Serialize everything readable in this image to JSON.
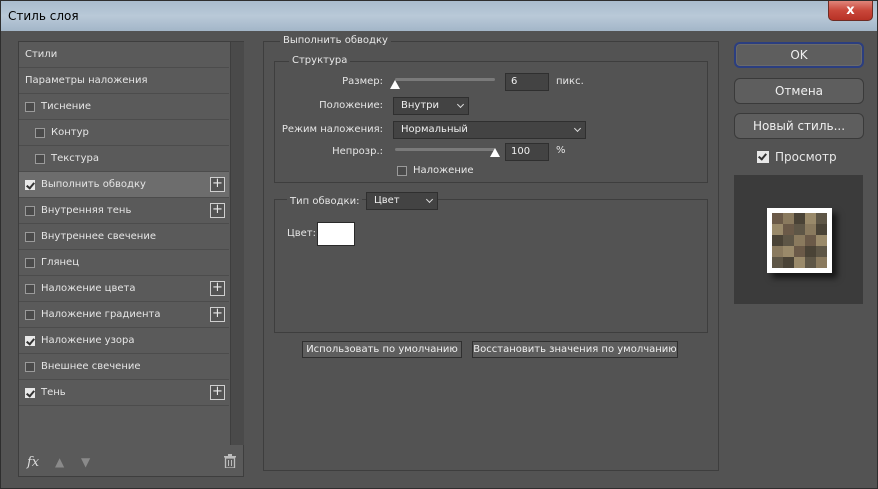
{
  "window": {
    "title": "Стиль слоя",
    "close_label": "x"
  },
  "left_panel": {
    "items": [
      {
        "label": "Стили",
        "checkbox": false,
        "checked": false,
        "indent": 0,
        "plus": false,
        "active": false
      },
      {
        "label": "Параметры наложения",
        "checkbox": false,
        "checked": false,
        "indent": 0,
        "plus": false,
        "active": false
      },
      {
        "label": "Тиснение",
        "checkbox": true,
        "checked": false,
        "indent": 0,
        "plus": false,
        "active": false
      },
      {
        "label": "Контур",
        "checkbox": true,
        "checked": false,
        "indent": 1,
        "plus": false,
        "active": false
      },
      {
        "label": "Текстура",
        "checkbox": true,
        "checked": false,
        "indent": 1,
        "plus": false,
        "active": false
      },
      {
        "label": "Выполнить обводку",
        "checkbox": true,
        "checked": true,
        "indent": 0,
        "plus": true,
        "active": true
      },
      {
        "label": "Внутренняя тень",
        "checkbox": true,
        "checked": false,
        "indent": 0,
        "plus": true,
        "active": false
      },
      {
        "label": "Внутреннее свечение",
        "checkbox": true,
        "checked": false,
        "indent": 0,
        "plus": false,
        "active": false
      },
      {
        "label": "Глянец",
        "checkbox": true,
        "checked": false,
        "indent": 0,
        "plus": false,
        "active": false
      },
      {
        "label": "Наложение цвета",
        "checkbox": true,
        "checked": false,
        "indent": 0,
        "plus": true,
        "active": false
      },
      {
        "label": "Наложение градиента",
        "checkbox": true,
        "checked": false,
        "indent": 0,
        "plus": true,
        "active": false
      },
      {
        "label": "Наложение узора",
        "checkbox": true,
        "checked": true,
        "indent": 0,
        "plus": false,
        "active": false
      },
      {
        "label": "Внешнее свечение",
        "checkbox": true,
        "checked": false,
        "indent": 0,
        "plus": false,
        "active": false
      },
      {
        "label": "Тень",
        "checkbox": true,
        "checked": true,
        "indent": 0,
        "plus": true,
        "active": false
      }
    ],
    "footer": {
      "fx_label": "fx",
      "up_arrow": "▲",
      "down_arrow": "▼"
    }
  },
  "stroke": {
    "title": "Выполнить обводку",
    "structure": {
      "title": "Структура",
      "size_label": "Размер:",
      "size_value": "6",
      "size_unit": "пикс.",
      "size_slider_fraction": 0.0,
      "position_label": "Положение:",
      "position_value": "Внутри",
      "blend_label": "Режим наложения:",
      "blend_value": "Нормальный",
      "opacity_label": "Непрозр.:",
      "opacity_value": "100",
      "opacity_unit": "%",
      "opacity_slider_fraction": 1.0,
      "overprint_label": "Наложение",
      "overprint_checked": false
    },
    "fill_type": {
      "label": "Тип обводки:",
      "value": "Цвет",
      "color_label": "Цвет:",
      "color": "#ffffff"
    },
    "make_default_label": "Использовать по умолчанию",
    "reset_default_label": "Восстановить значения по умолчанию"
  },
  "right_panel": {
    "ok_label": "OK",
    "cancel_label": "Отмена",
    "new_style_label": "Новый стиль...",
    "preview_label": "Просмотр",
    "preview_checked": true
  },
  "colors": {
    "dialog_bg": "#535353",
    "panel_bg": "#5a5a5a",
    "active_row": "#6d6d6d",
    "input_bg": "#434343",
    "ok_border": "#2b3e80",
    "close_button": "#c9473a",
    "preview_pattern": [
      "#6b5a48",
      "#8a7a5e",
      "#4a4336",
      "#9a8a6a",
      "#5e5646"
    ]
  }
}
